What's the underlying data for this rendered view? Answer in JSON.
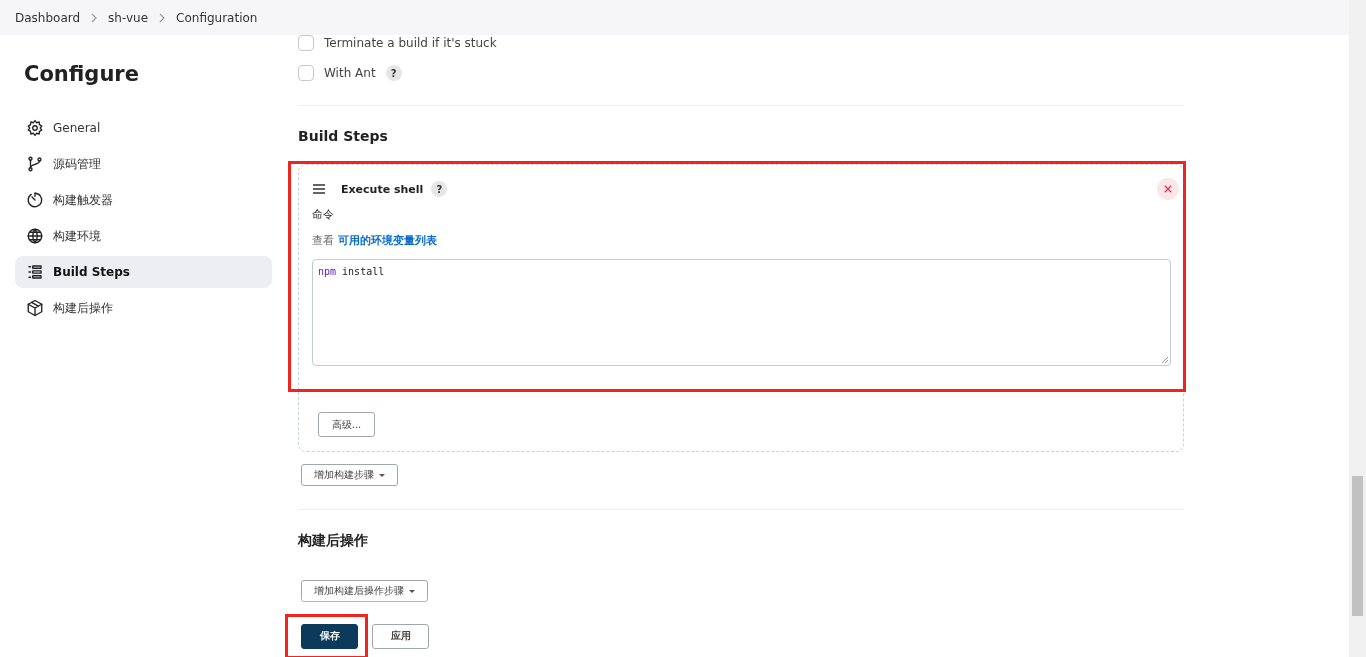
{
  "breadcrumbs": [
    {
      "label": "Dashboard"
    },
    {
      "label": "sh-vue"
    },
    {
      "label": "Configuration"
    }
  ],
  "sidebar": {
    "title": "Configure",
    "items": [
      {
        "label": "General",
        "selected": false
      },
      {
        "label": "源码管理",
        "selected": false
      },
      {
        "label": "构建触发器",
        "selected": false
      },
      {
        "label": "构建环境",
        "selected": false
      },
      {
        "label": "Build Steps",
        "selected": true
      },
      {
        "label": "构建后操作",
        "selected": false
      }
    ]
  },
  "options": [
    {
      "label": "Terminate a build if it's stuck",
      "checked": false
    },
    {
      "label": "With Ant",
      "checked": false,
      "help": "?"
    }
  ],
  "build_steps": {
    "title": "Build Steps",
    "steps": [
      {
        "title": "Execute shell",
        "help": "?",
        "highlighted": true,
        "command_label": "命令",
        "env_prefix": "查看",
        "env_link": "可用的环境变量列表",
        "command": [
          {
            "text": "npm",
            "kind": "keyword"
          },
          {
            "text": " install",
            "kind": "plain"
          }
        ],
        "advanced_button": "高级..."
      }
    ],
    "add_button": "增加构建步骤"
  },
  "post_build": {
    "title": "构建后操作",
    "add_button": "增加构建后操作步骤"
  },
  "footer": {
    "buttons": [
      {
        "label": "保存",
        "kind": "primary",
        "highlighted": true
      },
      {
        "label": "应用",
        "kind": "secondary",
        "highlighted": false
      }
    ]
  }
}
